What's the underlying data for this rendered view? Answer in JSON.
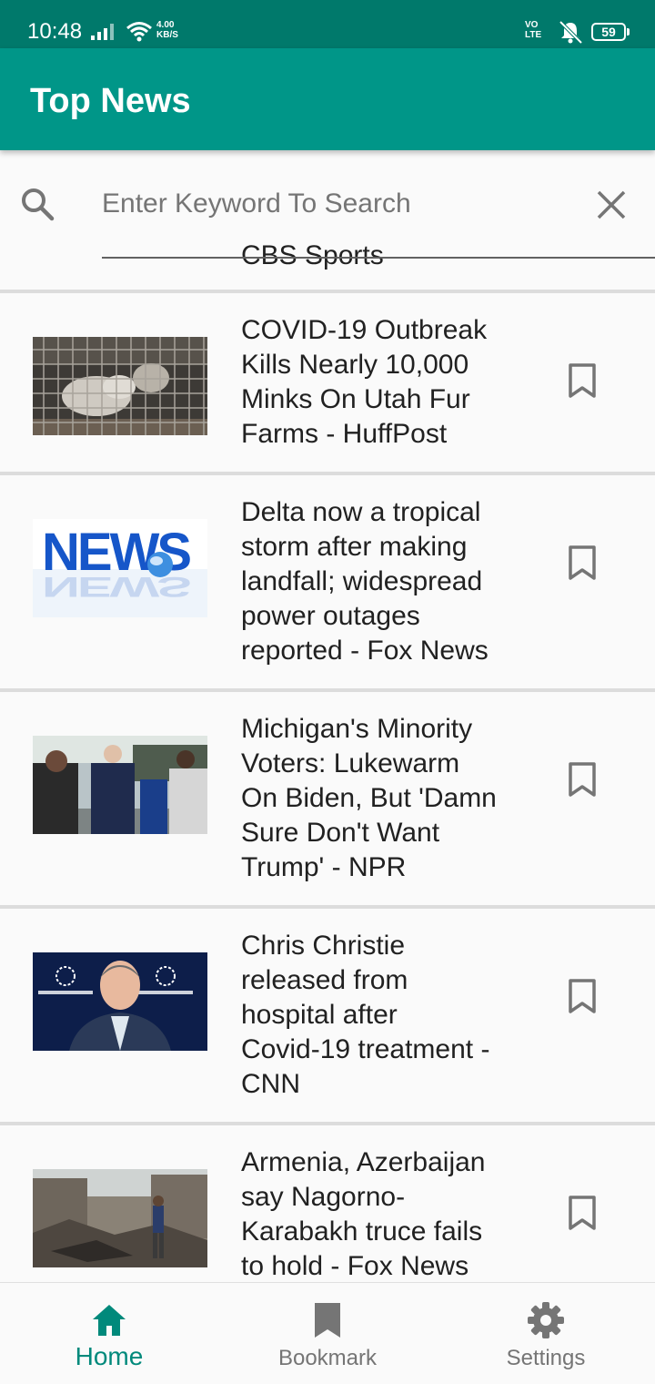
{
  "status_bar": {
    "time": "10:48",
    "speed_value": "4.00",
    "speed_unit": "KB/S",
    "volte_top": "VO",
    "volte_bottom": "LTE",
    "battery": "59"
  },
  "app_bar": {
    "title": "Top News"
  },
  "search": {
    "placeholder": "Enter Keyword To Search",
    "value": "",
    "peek_text": "CBS Sports"
  },
  "news": [
    {
      "title": "COVID-19 Outbreak Kills Nearly 10,000 Minks On Utah Fur Farms - HuffPost",
      "image": "mink-cage-photo",
      "lines": [
        "COVID-19 Outbreak",
        "Kills Nearly 10,000",
        "Minks On Utah Fur",
        "Farms - HuffPost"
      ]
    },
    {
      "title": "Delta now a tropical storm after making landfall; widespread power outages reported - Fox News",
      "image": "news-logo-graphic",
      "lines": [
        "Delta now a tropical",
        "storm after making",
        "landfall; widespread",
        "power outages",
        "reported - Fox News"
      ]
    },
    {
      "title": "Michigan's Minority Voters: Lukewarm On Biden, But 'Damn Sure Don't Want Trump' - NPR",
      "image": "biden-voters-photo",
      "lines": [
        "Michigan's Minority",
        "Voters: Lukewarm",
        "On Biden, But 'Damn",
        "Sure Don't Want",
        "Trump' - NPR"
      ]
    },
    {
      "title": "Chris Christie released from hospital after Covid-19 treatment - CNN",
      "image": "christie-concordia-photo",
      "lines": [
        "Chris Christie",
        "released from",
        "hospital after",
        "Covid-19 treatment -",
        "CNN"
      ]
    },
    {
      "title": "Armenia, Azerbaijan say Nagorno-Karabakh truce fails to hold - Fox News",
      "image": "rubble-photo",
      "lines": [
        "Armenia, Azerbaijan",
        "say Nagorno-",
        "Karabakh truce fails",
        "to hold - Fox News"
      ]
    }
  ],
  "bottom_nav": {
    "home": "Home",
    "bookmark": "Bookmark",
    "settings": "Settings"
  },
  "colors": {
    "status_bar": "#00796b",
    "app_bar": "#009688",
    "accent": "#00897b",
    "icon_gray": "#757575"
  }
}
